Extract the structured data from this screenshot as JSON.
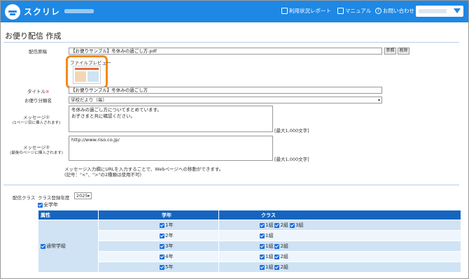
{
  "header": {
    "app_name": "スクリレ",
    "nav_report": "利用状況レポート",
    "nav_manual": "マニュアル",
    "nav_contact": "お問い合わせ",
    "accent": "#1e88e5"
  },
  "page": {
    "title": "お便り配信 作成"
  },
  "form": {
    "file_label": "配信原稿",
    "file_value": "【お便りサンプル】冬休みの過ごし方.pdf",
    "browse_label": "参照",
    "delete_label": "削除",
    "preview_label": "ファイルプレビュー",
    "title_label": "タイトル",
    "title_req": "※",
    "title_value": "【お便りサンプル】冬休みの過ごし方",
    "category_label": "お便り分類名",
    "category_value": "学校だより（毎）",
    "msg1_label": "メッセージ①",
    "msg1_sub": "(1ページ目に挿入されます)",
    "msg1_line1": "冬休みの過ごし方についてまとめています。",
    "msg1_line2": "お子さまと共に確認ください。",
    "msg1_max": "[最大1,000文字]",
    "msg2_label": "メッセージ②",
    "msg2_sub": "(最後のページに挿入されます)",
    "msg2_value": "http://www.riso.co.jp/",
    "msg2_max": "[最大1,000文字]",
    "note1": "メッセージ入力欄にURLを入力することで、Webページへの移動ができます。",
    "note2": "(記号：\"<\"、\">\"の2種類は使用不可)"
  },
  "class_section": {
    "label": "配信クラス",
    "year_label": "クラス登録年度",
    "year_value": "2025",
    "all_grades": "全学年",
    "col_attr": "属性",
    "col_grade": "学年",
    "col_class": "クラス",
    "attr_value": "通常学級",
    "rows": [
      {
        "grade": "1年",
        "classes": [
          "1組",
          "2組",
          "3組"
        ]
      },
      {
        "grade": "2年",
        "classes": [
          "1組"
        ]
      },
      {
        "grade": "3年",
        "classes": [
          "1組",
          "2組"
        ]
      },
      {
        "grade": "4年",
        "classes": [
          "1組",
          "2組"
        ]
      },
      {
        "grade": "5年",
        "classes": [
          "1組",
          "2組"
        ]
      }
    ]
  }
}
